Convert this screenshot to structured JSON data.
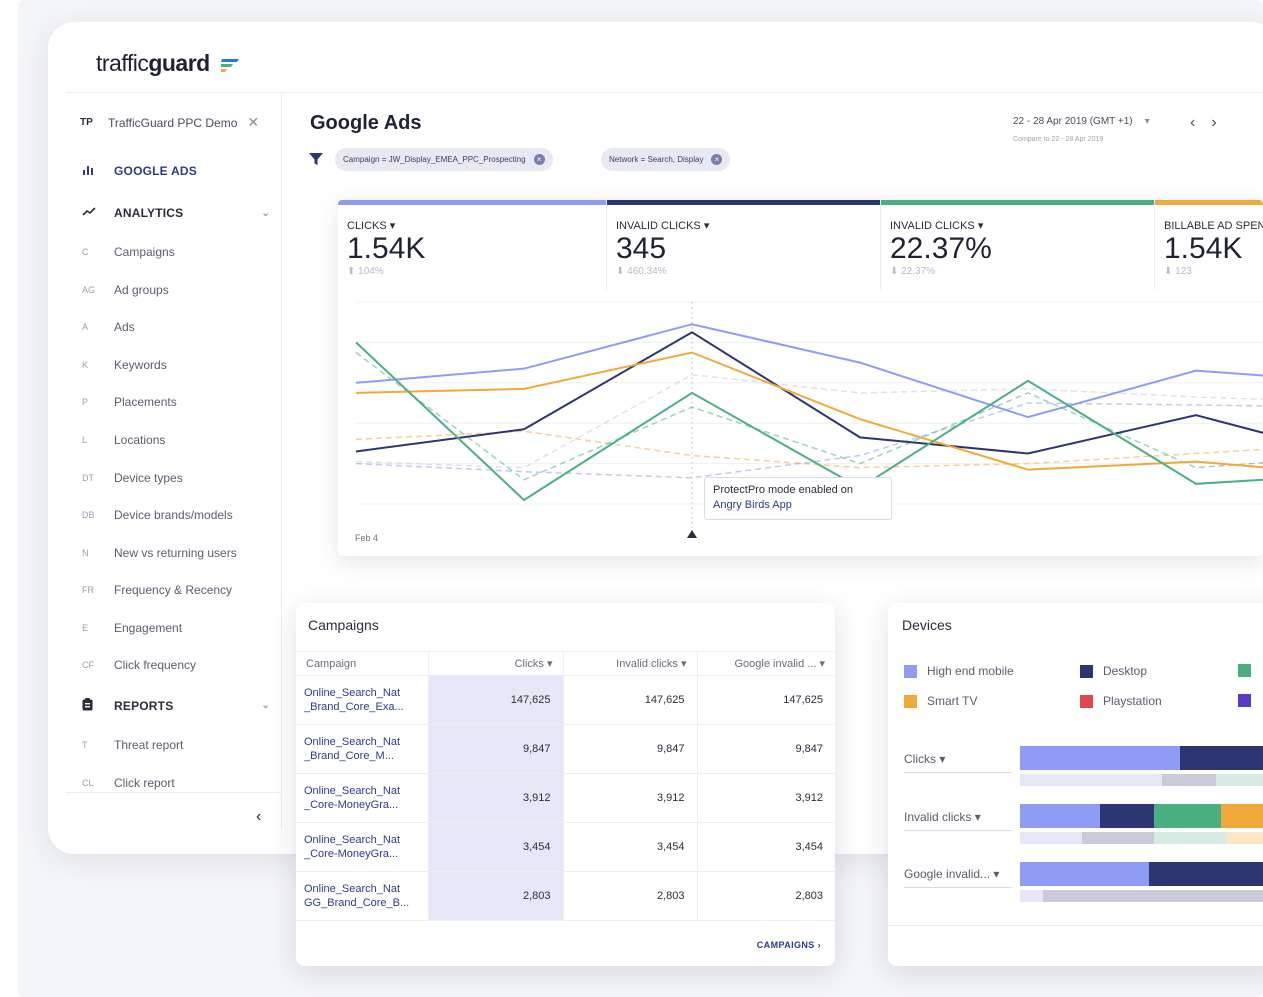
{
  "app": {
    "logo_light": "traffic",
    "logo_bold": "guard"
  },
  "sidebar": {
    "account_abbr": "TP",
    "account_name": "TrafficGuard PPC Demo",
    "close_symbol": "✕",
    "google_ads_label": "GOOGLE ADS",
    "analytics_label": "ANALYTICS",
    "analytics_items": [
      {
        "abbr": "C",
        "label": "Campaigns"
      },
      {
        "abbr": "AG",
        "label": "Ad groups"
      },
      {
        "abbr": "A",
        "label": "Ads"
      },
      {
        "abbr": "K",
        "label": "Keywords"
      },
      {
        "abbr": "P",
        "label": "Placements"
      },
      {
        "abbr": "L",
        "label": "Locations"
      },
      {
        "abbr": "DT",
        "label": "Device types"
      },
      {
        "abbr": "DB",
        "label": "Device brands/models"
      },
      {
        "abbr": "N",
        "label": "New vs returning users"
      },
      {
        "abbr": "FR",
        "label": "Frequency & Recency"
      },
      {
        "abbr": "E",
        "label": "Engagement"
      },
      {
        "abbr": "CF",
        "label": "Click frequency"
      }
    ],
    "reports_label": "REPORTS",
    "report_items": [
      {
        "abbr": "T",
        "label": "Threat report"
      },
      {
        "abbr": "CL",
        "label": "Click report"
      }
    ],
    "collapse_symbol": "‹"
  },
  "header": {
    "title": "Google Ads",
    "filters": [
      "Campaign = JW_Display_EMEA_PPC_Prospecting",
      "Network = Search, Display"
    ],
    "date_range": "22 - 28 Apr 2019 (GMT +1)",
    "compare_text": "Compare to 22 - 28 Apr 2019",
    "prev_symbol": "‹",
    "next_symbol": "›"
  },
  "kpis": [
    {
      "label": "CLICKS ▾",
      "value": "1.54K",
      "delta": "⬆ 104%",
      "color": "#8f9cf5"
    },
    {
      "label": "INVALID CLICKS ▾",
      "value": "345",
      "delta": "⬇ 460.34%",
      "color": "#2e3573"
    },
    {
      "label": "INVALID CLICKS ▾",
      "value": "22.37%",
      "delta": "⬇ 22.37%",
      "color": "#4caf82"
    },
    {
      "label": "BILLABLE AD SPEND ▾",
      "value": "1.54K",
      "delta": "⬇ 123",
      "color": "#f2a93b"
    }
  ],
  "chart_data": {
    "type": "line",
    "x_first_label": "Feb 4",
    "series": [
      {
        "color": "#8f9cf5",
        "dashed": false,
        "values": [
          60,
          67,
          89,
          70,
          43,
          66,
          60
        ]
      },
      {
        "color": "#2e3573",
        "dashed": false,
        "values": [
          26,
          37,
          85,
          33,
          25,
          44,
          22
        ]
      },
      {
        "color": "#f2a93b",
        "dashed": false,
        "values": [
          55,
          57,
          75,
          42,
          17,
          21,
          14
        ]
      },
      {
        "color": "#4caf82",
        "dashed": false,
        "values": [
          80,
          2,
          55,
          8,
          61,
          10,
          15
        ]
      },
      {
        "color": "#8f9cf5",
        "dashed": true,
        "values": [
          20,
          16,
          13,
          24,
          50,
          49,
          48
        ]
      },
      {
        "color": "#f2a93b",
        "dashed": true,
        "values": [
          32,
          36,
          24,
          18,
          20,
          25,
          30
        ]
      },
      {
        "color": "#4caf82",
        "dashed": true,
        "values": [
          75,
          12,
          48,
          20,
          55,
          18,
          24
        ]
      },
      {
        "color": "#c9c7e6",
        "dashed": true,
        "values": [
          21,
          18,
          64,
          55,
          57,
          53,
          50
        ]
      }
    ],
    "ylim": [
      0,
      100
    ],
    "grid": true,
    "annotation": {
      "text": "ProtectPro mode enabled on",
      "link": "Angry Birds App"
    }
  },
  "campaigns": {
    "title": "Campaigns",
    "columns": [
      "Campaign",
      "Clicks ▾",
      "Invalid clicks ▾",
      "Google invalid ... ▾"
    ],
    "rows": [
      {
        "name1": "Online_Search_Nat",
        "name2": "_Brand_Core_Exa...",
        "clicks": "147,625",
        "invalid": "147,625",
        "google": "147,625"
      },
      {
        "name1": "Online_Search_Nat",
        "name2": "_Brand_Core_M...",
        "clicks": "9,847",
        "invalid": "9,847",
        "google": "9,847"
      },
      {
        "name1": "Online_Search_Nat",
        "name2": "_Core-MoneyGra...",
        "clicks": "3,912",
        "invalid": "3,912",
        "google": "3,912"
      },
      {
        "name1": "Online_Search_Nat",
        "name2": "_Core-MoneyGra...",
        "clicks": "3,454",
        "invalid": "3,454",
        "google": "3,454"
      },
      {
        "name1": "Online_Search_Nat",
        "name2": "GG_Brand_Core_B...",
        "clicks": "2,803",
        "invalid": "2,803",
        "google": "2,803"
      }
    ],
    "link_label": "CAMPAIGNS ›"
  },
  "devices": {
    "title": "Devices",
    "legend": [
      {
        "label": "High end mobile",
        "color": "#8f9cf5"
      },
      {
        "label": "Desktop",
        "color": "#2e3573"
      },
      {
        "label": "",
        "color": "#4caf82"
      },
      {
        "label": "Smart TV",
        "color": "#f2a93b"
      },
      {
        "label": "Playstation",
        "color": "#e0484b"
      },
      {
        "label": "",
        "color": "#5a3cc4"
      }
    ],
    "metrics": [
      {
        "label": "Clicks ▾",
        "segments": [
          {
            "share": 0.62,
            "color": "#8f9cf5"
          },
          {
            "share": 0.38,
            "color": "#2e3573"
          }
        ],
        "compare": [
          {
            "share": 0.55,
            "color": "#e6e8f7"
          },
          {
            "share": 0.21,
            "color": "#c9cbd8"
          },
          {
            "share": 0.18,
            "color": "#d6ece2"
          },
          {
            "share": 0.06,
            "color": "#fbe6c6"
          }
        ]
      },
      {
        "label": "Invalid clicks ▾",
        "segments": [
          {
            "share": 0.31,
            "color": "#8f9cf5"
          },
          {
            "share": 0.21,
            "color": "#2e3573"
          },
          {
            "share": 0.26,
            "color": "#4caf82"
          },
          {
            "share": 0.22,
            "color": "#f2a93b"
          }
        ],
        "compare": [
          {
            "share": 0.24,
            "color": "#e6e8f7"
          },
          {
            "share": 0.28,
            "color": "#c9cbd8"
          },
          {
            "share": 0.28,
            "color": "#d6ece2"
          },
          {
            "share": 0.2,
            "color": "#fbe6c6"
          }
        ]
      },
      {
        "label": "Google invalid... ▾",
        "segments": [
          {
            "share": 0.5,
            "color": "#8f9cf5"
          },
          {
            "share": 0.5,
            "color": "#2e3573"
          }
        ],
        "compare": [
          {
            "share": 0.09,
            "color": "#e6e8f7"
          },
          {
            "share": 0.91,
            "color": "#c9cbd8"
          }
        ]
      }
    ]
  }
}
